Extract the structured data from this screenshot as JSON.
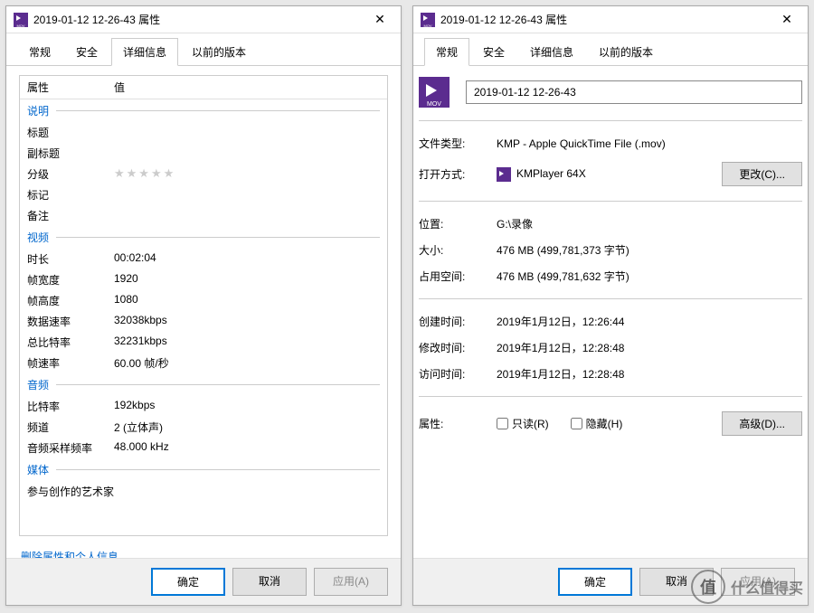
{
  "left": {
    "title": "2019-01-12 12-26-43 属性",
    "tabs": [
      "常规",
      "安全",
      "详细信息",
      "以前的版本"
    ],
    "active_tab": 2,
    "header_prop": "属性",
    "header_val": "值",
    "sections": {
      "desc_header": "说明",
      "desc_rows": [
        {
          "label": "标题",
          "value": ""
        },
        {
          "label": "副标题",
          "value": ""
        },
        {
          "label": "分级",
          "value": "★★★★★",
          "stars": true
        },
        {
          "label": "标记",
          "value": ""
        },
        {
          "label": "备注",
          "value": ""
        }
      ],
      "video_header": "视频",
      "video_rows": [
        {
          "label": "时长",
          "value": "00:02:04"
        },
        {
          "label": "帧宽度",
          "value": "1920"
        },
        {
          "label": "帧高度",
          "value": "1080"
        },
        {
          "label": "数据速率",
          "value": "32038kbps"
        },
        {
          "label": "总比特率",
          "value": "32231kbps"
        },
        {
          "label": "帧速率",
          "value": "60.00 帧/秒"
        }
      ],
      "audio_header": "音频",
      "audio_rows": [
        {
          "label": "比特率",
          "value": "192kbps"
        },
        {
          "label": "频道",
          "value": "2 (立体声)"
        },
        {
          "label": "音频采样频率",
          "value": "48.000 kHz"
        }
      ],
      "media_header": "媒体",
      "media_rows": [
        {
          "label": "参与创作的艺术家",
          "value": ""
        }
      ]
    },
    "link": "删除属性和个人信息",
    "buttons": {
      "ok": "确定",
      "cancel": "取消",
      "apply": "应用(A)"
    }
  },
  "right": {
    "title": "2019-01-12 12-26-43 属性",
    "tabs": [
      "常规",
      "安全",
      "详细信息",
      "以前的版本"
    ],
    "active_tab": 0,
    "filename": "2019-01-12 12-26-43",
    "type_label": "文件类型:",
    "type_value": "KMP - Apple QuickTime File (.mov)",
    "openwith_label": "打开方式:",
    "openwith_value": "KMPlayer 64X",
    "change_btn": "更改(C)...",
    "location_label": "位置:",
    "location_value": "G:\\录像",
    "size_label": "大小:",
    "size_value": "476 MB (499,781,373 字节)",
    "diskspace_label": "占用空间:",
    "diskspace_value": "476 MB (499,781,632 字节)",
    "created_label": "创建时间:",
    "created_value": "2019年1月12日，12:26:44",
    "modified_label": "修改时间:",
    "modified_value": "2019年1月12日，12:28:48",
    "accessed_label": "访问时间:",
    "accessed_value": "2019年1月12日，12:28:48",
    "attr_label": "属性:",
    "readonly_label": "只读(R)",
    "hidden_label": "隐藏(H)",
    "advanced_btn": "高级(D)...",
    "buttons": {
      "ok": "确定",
      "cancel": "取消",
      "apply": "应用(A)"
    }
  },
  "watermark": {
    "circle": "值",
    "text": "什么值得买"
  }
}
